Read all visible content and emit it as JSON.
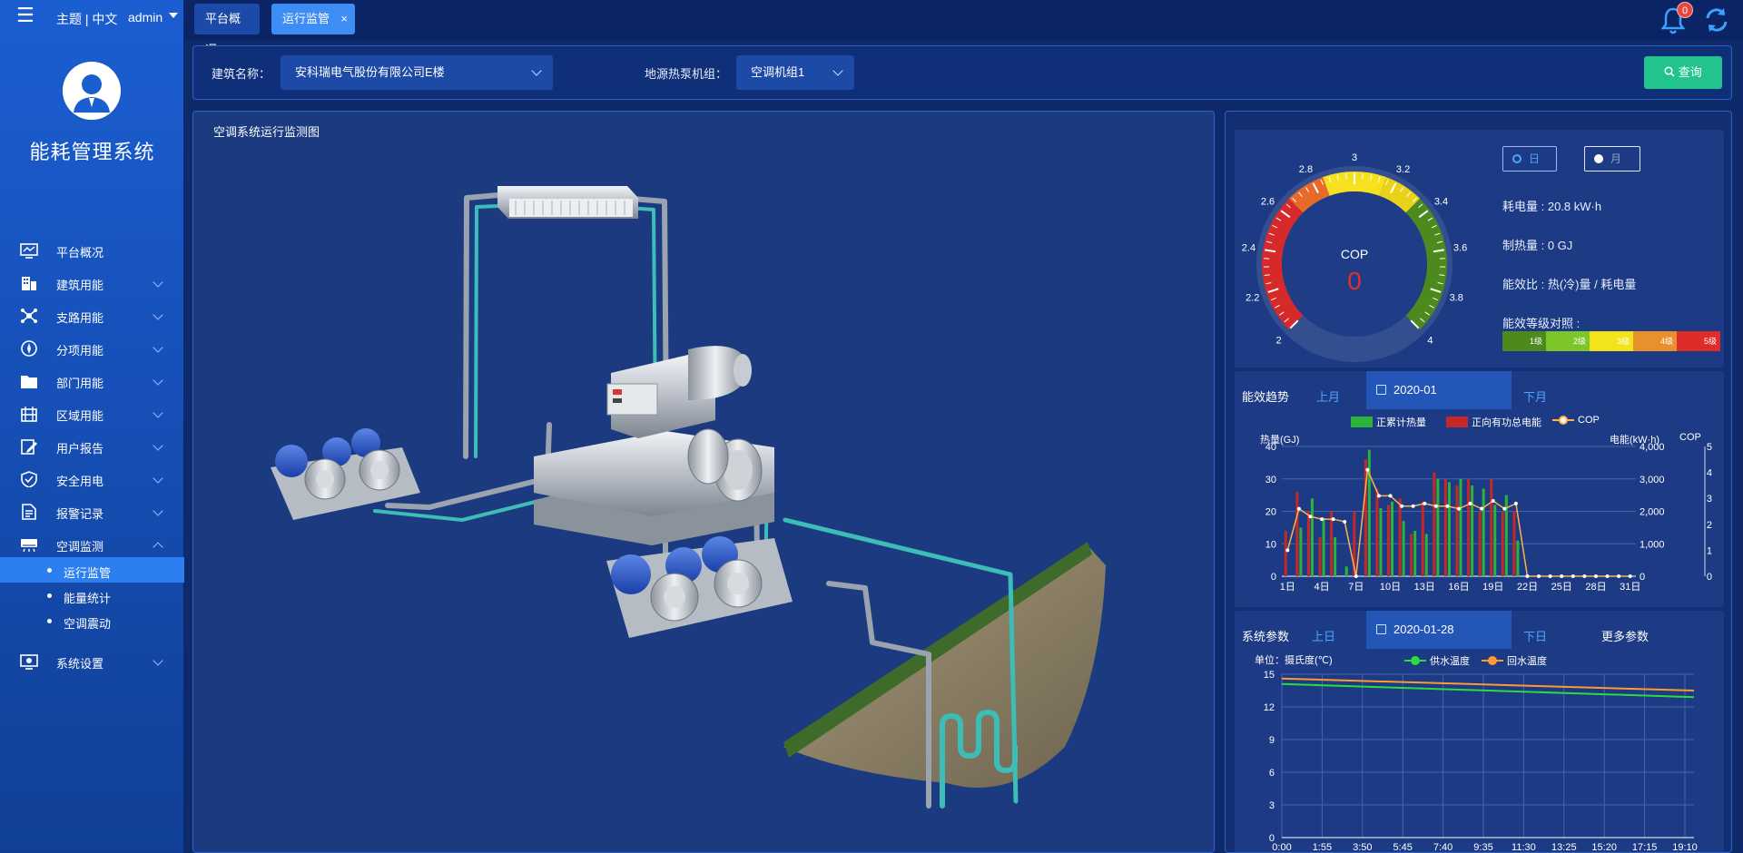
{
  "sidebar": {
    "theme_text": "主题 | 中文",
    "user": "admin",
    "app_title": "能耗管理系统",
    "items": [
      {
        "label": "平台概况",
        "icon": "monitor-icon",
        "has_children": false
      },
      {
        "label": "建筑用能",
        "icon": "building-icon",
        "has_children": true
      },
      {
        "label": "支路用能",
        "icon": "network-icon",
        "has_children": true
      },
      {
        "label": "分项用能",
        "icon": "compass-icon",
        "has_children": true
      },
      {
        "label": "部门用能",
        "icon": "folder-icon",
        "has_children": true
      },
      {
        "label": "区域用能",
        "icon": "region-icon",
        "has_children": true
      },
      {
        "label": "用户报告",
        "icon": "report-edit-icon",
        "has_children": true
      },
      {
        "label": "安全用电",
        "icon": "shield-icon",
        "has_children": true
      },
      {
        "label": "报警记录",
        "icon": "document-icon",
        "has_children": true
      },
      {
        "label": "空调监测",
        "icon": "aircon-icon",
        "has_children": true,
        "expanded": true
      },
      {
        "label": "系统设置",
        "icon": "settings-icon",
        "has_children": true
      }
    ],
    "sub_items": [
      {
        "label": "运行监管",
        "active": true
      },
      {
        "label": "能量统计",
        "active": false
      },
      {
        "label": "空调震动",
        "active": false
      }
    ]
  },
  "tabs": [
    {
      "label": "平台概况",
      "active": false
    },
    {
      "label": "运行监管",
      "active": true,
      "closable": true
    }
  ],
  "close_symbol": "×",
  "notifications": {
    "count": "0"
  },
  "filter": {
    "building_label": "建筑名称：",
    "building_value": "安科瑞电气股份有限公司E楼",
    "unit_label": "地源热泵机组：",
    "unit_value": "空调机组1",
    "query_label": "查询"
  },
  "diagram": {
    "title": "空调系统运行监测图"
  },
  "gauge": {
    "label": "COP",
    "value": "0",
    "ticks": [
      "2",
      "2.2",
      "2.4",
      "2.6",
      "2.8",
      "3",
      "3.2",
      "3.4",
      "3.6",
      "3.8",
      "4"
    ],
    "period_day": "日",
    "period_month": "月",
    "power_text": "耗电量 : 20.8 kW·h",
    "heat_text": "制热量 : 0 GJ",
    "ratio_text": "能效比 : 热(冷)量 / 耗电量",
    "grade_title": "能效等级对照 :",
    "grades": [
      {
        "label": "1级",
        "color": "#4d8a1e"
      },
      {
        "label": "2级",
        "color": "#7cc629"
      },
      {
        "label": "3级",
        "color": "#f2e41a"
      },
      {
        "label": "4级",
        "color": "#e88f2e"
      },
      {
        "label": "5级",
        "color": "#e02b2b"
      }
    ]
  },
  "trend": {
    "title": "能效趋势",
    "prev": "上月",
    "date": "2020-01",
    "next": "下月",
    "legend_heat": "正累计热量",
    "legend_power": "正向有功总电能",
    "legend_cop": "COP",
    "left_axis": "热量(GJ)",
    "right_axis1": "电能(kW·h)",
    "right_axis2": "COP"
  },
  "params": {
    "title": "系统参数",
    "prev": "上日",
    "date": "2020-01-28",
    "next": "下日",
    "more": "更多参数",
    "unit": "单位：摄氏度(℃)",
    "legend_supply": "供水温度",
    "legend_return": "回水温度"
  },
  "chart_data": [
    {
      "type": "bar",
      "title": "能效趋势",
      "categories": [
        "1日",
        "2日",
        "3日",
        "4日",
        "5日",
        "6日",
        "7日",
        "8日",
        "9日",
        "10日",
        "11日",
        "12日",
        "13日",
        "14日",
        "15日",
        "16日",
        "17日",
        "18日",
        "19日",
        "20日",
        "21日",
        "22日",
        "23日",
        "24日",
        "25日",
        "26日",
        "27日",
        "28日",
        "29日",
        "30日",
        "31日"
      ],
      "x_tick_labels": [
        "1日",
        "4日",
        "7日",
        "10日",
        "13日",
        "16日",
        "19日",
        "22日",
        "25日",
        "28日",
        "31日"
      ],
      "series": [
        {
          "name": "正累计热量",
          "axis": "left",
          "color": "#2bb33a",
          "values": [
            0,
            15,
            24,
            18,
            12,
            3,
            0,
            39,
            21,
            23,
            17,
            14,
            13,
            30,
            29,
            30,
            28,
            27,
            22,
            25,
            11,
            0,
            0,
            0,
            0,
            0,
            0,
            0,
            0,
            0,
            0
          ]
        },
        {
          "name": "正向有功总电能",
          "axis": "right",
          "color": "#c62828",
          "values": [
            1400,
            2600,
            2000,
            1200,
            2000,
            0,
            2000,
            3600,
            2700,
            2200,
            2400,
            1300,
            2300,
            3200,
            3000,
            2800,
            3000,
            2000,
            3000,
            2000,
            2000,
            0,
            0,
            0,
            0,
            0,
            0,
            0,
            0,
            0,
            0
          ]
        },
        {
          "name": "COP",
          "axis": "right2",
          "type": "line",
          "color": "#ffb24a",
          "values": [
            1,
            2.6,
            2.3,
            2.2,
            2.2,
            2.1,
            0,
            4.1,
            3.1,
            3.1,
            2.7,
            2.7,
            2.8,
            2.7,
            2.7,
            2.6,
            2.8,
            2.6,
            2.9,
            2.6,
            2.8,
            0,
            0,
            0,
            0,
            0,
            0,
            0,
            0,
            0,
            0
          ]
        }
      ],
      "ylim_left": [
        0,
        40
      ],
      "ylim_right": [
        0,
        4000
      ],
      "ylim_right2": [
        0,
        5
      ],
      "left_ticks": [
        "0",
        "10",
        "20",
        "30",
        "40"
      ],
      "right_ticks": [
        "0",
        "1,000",
        "2,000",
        "3,000",
        "4,000"
      ],
      "right2_ticks": [
        "0",
        "1",
        "2",
        "3",
        "4",
        "5"
      ]
    },
    {
      "type": "line",
      "title": "系统参数",
      "x_tick_labels": [
        "0:00",
        "1:55",
        "3:50",
        "5:45",
        "7:40",
        "9:35",
        "11:30",
        "13:25",
        "15:20",
        "17:15",
        "19:10"
      ],
      "series": [
        {
          "name": "供水温度",
          "color": "#2ddc3c",
          "start": 14.1,
          "end": 12.9
        },
        {
          "name": "回水温度",
          "color": "#ff9a2e",
          "start": 14.6,
          "end": 13.5
        }
      ],
      "ylim": [
        0,
        15
      ],
      "y_ticks": [
        "0",
        "3",
        "6",
        "9",
        "12",
        "15"
      ]
    }
  ]
}
